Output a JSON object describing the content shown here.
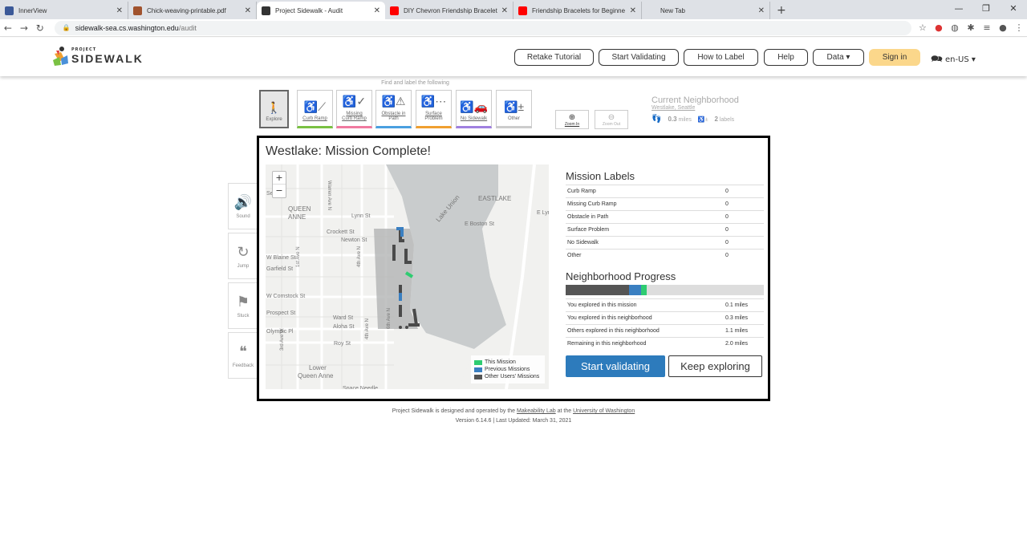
{
  "browser": {
    "tabs": [
      {
        "title": "InnerView",
        "favicon_color": "#3b5998",
        "active": false
      },
      {
        "title": "Chick-weaving-printable.pdf",
        "favicon_color": "#a0522d",
        "active": false
      },
      {
        "title": "Project Sidewalk - Audit",
        "favicon_color": "#333333",
        "active": true
      },
      {
        "title": "DIY Chevron Friendship Bracelet",
        "favicon_color": "#ff0000",
        "active": false
      },
      {
        "title": "Friendship Bracelets for Beginne",
        "favicon_color": "#ff0000",
        "active": false
      },
      {
        "title": "New Tab",
        "favicon_color": "#dee1e6",
        "active": false
      }
    ],
    "url_host": "sidewalk-sea.cs.washington.edu",
    "url_path": "/audit"
  },
  "header": {
    "logo_small": "PROJECT",
    "logo_big": "SIDEWALK",
    "buttons": {
      "retake": "Retake Tutorial",
      "start_validating": "Start Validating",
      "how_to_label": "How to Label",
      "help": "Help",
      "data": "Data ▾",
      "sign_in": "Sign in"
    },
    "lang": "en-US ▾"
  },
  "toolbar": {
    "find_label": "Find and label the following",
    "explore": "Explore",
    "curb_ramp": "Curb Ramp",
    "missing_curb_ramp_1": "Missing",
    "missing_curb_ramp_2": "Curb Ramp",
    "obstacle_1": "Obstacle in",
    "obstacle_2": "Path",
    "surface_1": "Surface",
    "surface_2": "Problem",
    "no_sidewalk": "No Sidewalk",
    "other": "Other",
    "zoom_in": "Zoom In",
    "zoom_out": "Zoom Out"
  },
  "current_neighborhood": {
    "title": "Current Neighborhood",
    "name": "Westlake, Seattle",
    "miles": "0.3",
    "miles_unit": "miles",
    "labels": "2",
    "labels_unit": "labels"
  },
  "side_panel": {
    "sound": "Sound",
    "jump": "Jump",
    "stuck": "Stuck",
    "feedback": "Feedback"
  },
  "modal": {
    "title": "Westlake: Mission Complete!",
    "map_labels": [
      "Sea",
      "QUEEN",
      "ANNE",
      "Lynn St",
      "EASTLAKE",
      "E Boston St",
      "E Lyn",
      "Crockett St",
      "Newton St",
      "W Blaine St",
      "Garfield St",
      "W Comstock St",
      "Prospect St",
      "Ward St",
      "Aloha St",
      "Olympic Pl",
      "Roy St",
      "Lower",
      "Queen Anne",
      "Space Needle",
      "Lake Union",
      "1st Ave N",
      "4th Ave N",
      "3rd Ave W",
      "4th Ave N",
      "6th Ave N",
      "Warren Ave N"
    ],
    "map_zoom_in": "+",
    "map_zoom_out": "−",
    "legend": {
      "this_mission": "This Mission",
      "previous": "Previous Missions",
      "others": "Other Users' Missions",
      "colors": {
        "this": "#2ecc71",
        "previous": "#3a7fc1",
        "others": "#555555"
      }
    },
    "mission_labels_title": "Mission Labels",
    "mission_labels": [
      {
        "label": "Curb Ramp",
        "value": "0"
      },
      {
        "label": "Missing Curb Ramp",
        "value": "0"
      },
      {
        "label": "Obstacle in Path",
        "value": "0"
      },
      {
        "label": "Surface Problem",
        "value": "0"
      },
      {
        "label": "No Sidewalk",
        "value": "0"
      },
      {
        "label": "Other",
        "value": "0"
      }
    ],
    "progress_title": "Neighborhood Progress",
    "progress": {
      "others_fraction": 0.32,
      "previous_fraction": 0.06,
      "this_fraction": 0.03
    },
    "progress_rows": [
      {
        "label": "You explored in this mission",
        "value": "0.1 miles"
      },
      {
        "label": "You explored in this neighborhood",
        "value": "0.3 miles"
      },
      {
        "label": "Others explored in this neighborhood",
        "value": "1.1 miles"
      },
      {
        "label": "Remaining in this neighborhood",
        "value": "2.0 miles"
      }
    ],
    "start_validating": "Start validating",
    "keep_exploring": "Keep exploring"
  },
  "footer": {
    "line1_a": "Project Sidewalk is designed and operated by the ",
    "line1_link1": "Makeability Lab",
    "line1_b": " at the ",
    "line1_link2": "University of Washington",
    "line2": "Version 6.14.6 | Last Updated: March 31, 2021"
  }
}
